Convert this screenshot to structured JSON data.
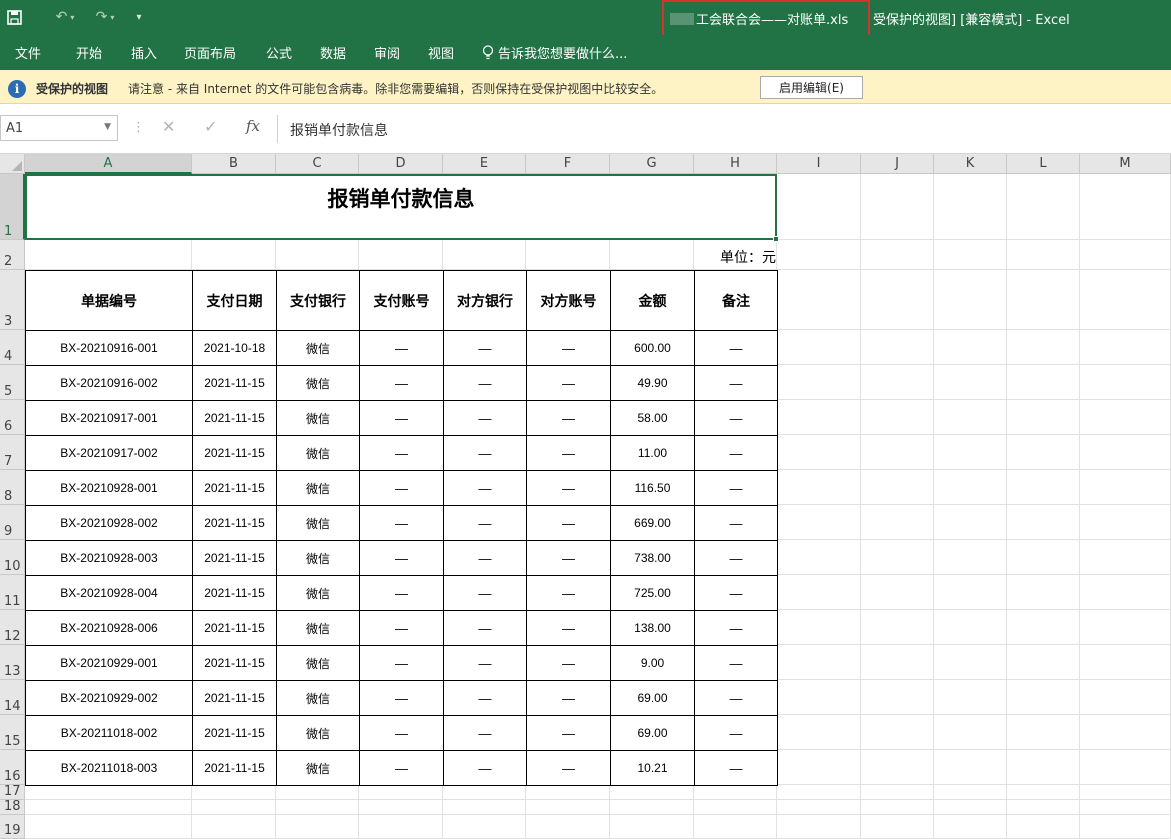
{
  "titlebar": {
    "undo_glyph": "↶",
    "redo_glyph": "↷",
    "qat_more_glyph": "▾",
    "file_name": "工会联合会——对账单.xls",
    "suffix": " 受保护的视图] [兼容模式] - Excel"
  },
  "ribbon": {
    "tabs": [
      "文件",
      "开始",
      "插入",
      "页面布局",
      "公式",
      "数据",
      "审阅",
      "视图"
    ],
    "tell_me": "告诉我您想要做什么..."
  },
  "protected_view": {
    "title": "受保护的视图",
    "message": "请注意 - 来自 Internet 的文件可能包含病毒。除非您需要编辑，否则保持在受保护视图中比较安全。",
    "enable_button": "启用编辑(E)"
  },
  "formula_bar": {
    "name_box": "A1",
    "cancel_glyph": "✕",
    "enter_glyph": "✓",
    "fx_label": "fx",
    "separator": "⋮",
    "formula": "报销单付款信息"
  },
  "grid": {
    "columns": [
      "A",
      "B",
      "C",
      "D",
      "E",
      "F",
      "G",
      "H",
      "I",
      "J",
      "K",
      "L",
      "M"
    ],
    "rows": [
      "1",
      "2",
      "3",
      "4",
      "5",
      "6",
      "7",
      "8",
      "9",
      "10",
      "11",
      "12",
      "13",
      "14",
      "15",
      "16",
      "17",
      "18",
      "19"
    ],
    "selected_column": "A",
    "selected_row": "1"
  },
  "sheet": {
    "title": "报销单付款信息",
    "unit": "单位：元",
    "headers": [
      "单据编号",
      "支付日期",
      "支付银行",
      "支付账号",
      "对方银行",
      "对方账号",
      "金额",
      "备注"
    ],
    "rows": [
      [
        "BX-20210916-001",
        "2021-10-18",
        "微信",
        "—",
        "—",
        "—",
        "600.00",
        "—"
      ],
      [
        "BX-20210916-002",
        "2021-11-15",
        "微信",
        "—",
        "—",
        "—",
        "49.90",
        "—"
      ],
      [
        "BX-20210917-001",
        "2021-11-15",
        "微信",
        "—",
        "—",
        "—",
        "58.00",
        "—"
      ],
      [
        "BX-20210917-002",
        "2021-11-15",
        "微信",
        "—",
        "—",
        "—",
        "11.00",
        "—"
      ],
      [
        "BX-20210928-001",
        "2021-11-15",
        "微信",
        "—",
        "—",
        "—",
        "116.50",
        "—"
      ],
      [
        "BX-20210928-002",
        "2021-11-15",
        "微信",
        "—",
        "—",
        "—",
        "669.00",
        "—"
      ],
      [
        "BX-20210928-003",
        "2021-11-15",
        "微信",
        "—",
        "—",
        "—",
        "738.00",
        "—"
      ],
      [
        "BX-20210928-004",
        "2021-11-15",
        "微信",
        "—",
        "—",
        "—",
        "725.00",
        "—"
      ],
      [
        "BX-20210928-006",
        "2021-11-15",
        "微信",
        "—",
        "—",
        "—",
        "138.00",
        "—"
      ],
      [
        "BX-20210929-001",
        "2021-11-15",
        "微信",
        "—",
        "—",
        "—",
        "9.00",
        "—"
      ],
      [
        "BX-20210929-002",
        "2021-11-15",
        "微信",
        "—",
        "—",
        "—",
        "69.00",
        "—"
      ],
      [
        "BX-20211018-002",
        "2021-11-15",
        "微信",
        "—",
        "—",
        "—",
        "69.00",
        "—"
      ],
      [
        "BX-20211018-003",
        "2021-11-15",
        "微信",
        "—",
        "—",
        "—",
        "10.21",
        "—"
      ]
    ]
  },
  "colors": {
    "excel_green": "#217346",
    "protected_bar": "#fdf3c4",
    "highlight_box": "#d9322e"
  }
}
